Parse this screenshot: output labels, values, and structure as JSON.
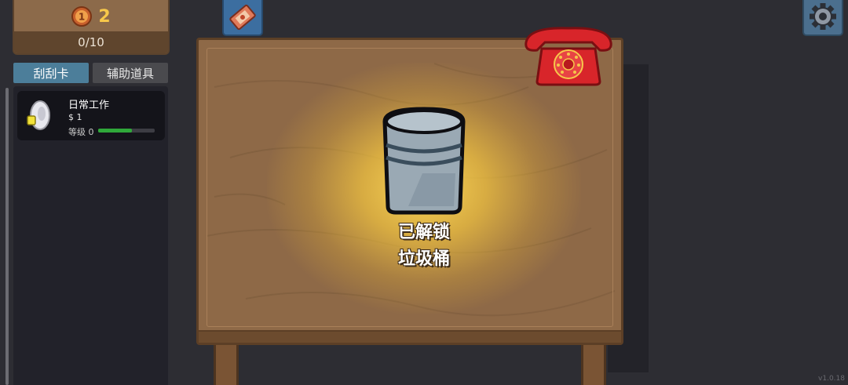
{
  "hud": {
    "coins": "2",
    "progress": "0/10"
  },
  "tabs": [
    {
      "label": "刮刮卡",
      "active": true
    },
    {
      "label": "辅助道具",
      "active": false
    }
  ],
  "card_list": [
    {
      "name": "日常工作",
      "price": "$ 1",
      "level_text": "等级 0",
      "level_progress": 0.6
    }
  ],
  "unlock": {
    "line1": "已解锁",
    "line2": "垃圾桶"
  },
  "icons": {
    "coin": "coin-icon",
    "ticket": "ticket-icon",
    "settings": "gear-icon",
    "phone": "telephone-icon",
    "bin": "trash-bin-icon"
  },
  "colors": {
    "table": "#8e6947",
    "glow": "#ffd957",
    "active_tab": "#4c7e9a",
    "level_fill": "#2fa83a",
    "coin_text": "#f7c84a"
  },
  "version": "v1.0.18"
}
